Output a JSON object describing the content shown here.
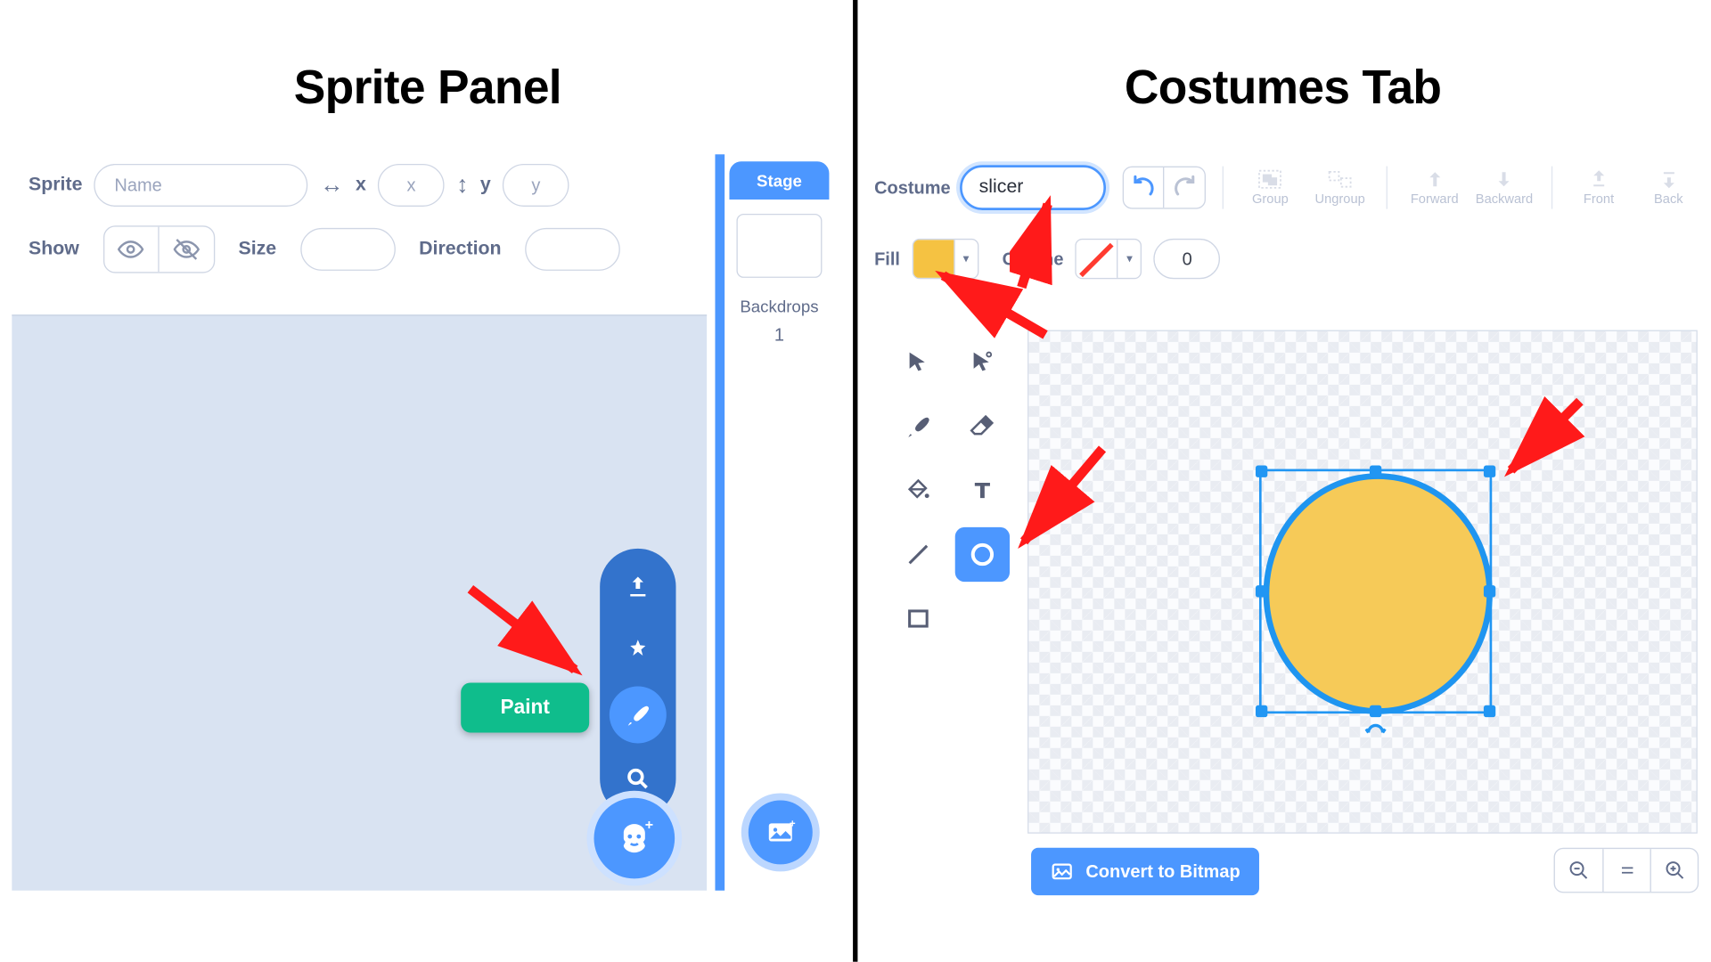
{
  "headings": {
    "left": "Sprite Panel",
    "right": "Costumes Tab"
  },
  "sprite_panel": {
    "sprite_label": "Sprite",
    "name_placeholder": "Name",
    "x_label": "x",
    "y_label": "y",
    "x_value": "x",
    "y_value": "y",
    "show_label": "Show",
    "size_label": "Size",
    "direction_label": "Direction",
    "paint_tooltip": "Paint",
    "stage_title": "Stage",
    "backdrops_label": "Backdrops",
    "backdrops_count": "1",
    "fab_items": [
      "upload",
      "surprise",
      "paint",
      "search"
    ]
  },
  "costumes_tab": {
    "costume_label": "Costume",
    "costume_name": "slicer",
    "fill_label": "Fill",
    "fill_color": "#f5c242",
    "outline_label": "Outline",
    "outline_none": true,
    "outline_width": "0",
    "toolbar": {
      "group": "Group",
      "ungroup": "Ungroup",
      "forward": "Forward",
      "backward": "Backward",
      "front": "Front",
      "back": "Back"
    },
    "tools": [
      "select",
      "reshape",
      "brush",
      "eraser",
      "fill",
      "text",
      "line",
      "circle",
      "rectangle"
    ],
    "selected_tool": "circle",
    "convert_label": "Convert to Bitmap",
    "shape": {
      "type": "circle",
      "fill": "#f5c95a",
      "stroke": "#1f95f0"
    }
  }
}
